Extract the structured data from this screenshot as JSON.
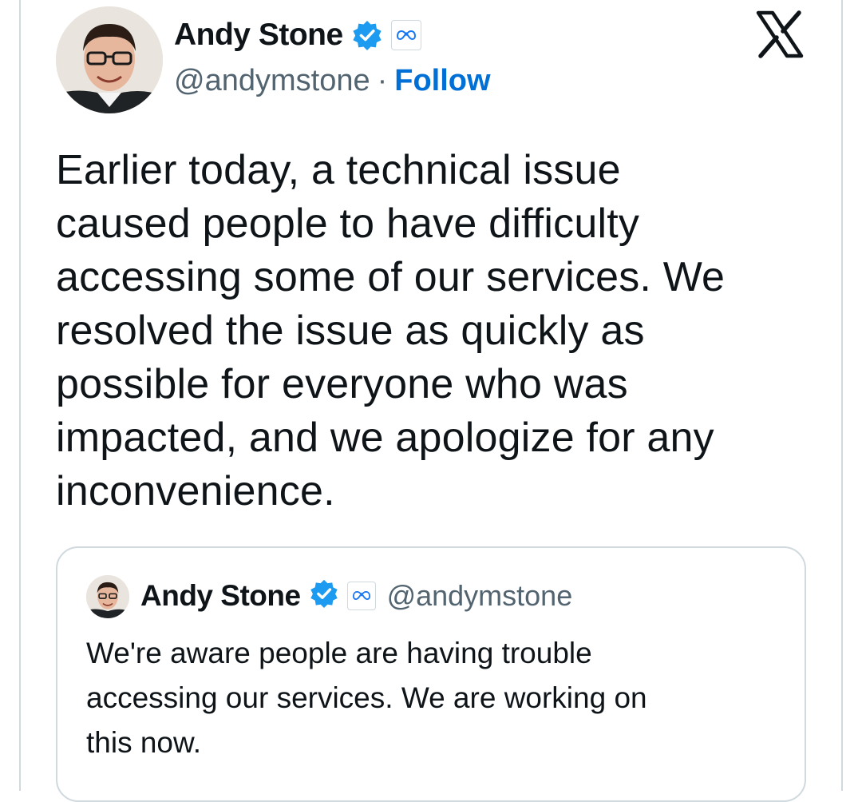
{
  "author": {
    "name": "Andy Stone",
    "handle": "@andymstone",
    "separator": "·",
    "follow_label": "Follow",
    "verified_icon": "verified-badge-icon",
    "affiliation_icon": "meta-logo-icon"
  },
  "platform": {
    "logo_icon": "x-logo-icon"
  },
  "tweet": {
    "text": "Earlier today, a technical issue\ncaused people to have difficulty\naccessing some of our services. We\nresolved the issue as quickly as\npossible for everyone who was\nimpacted, and we apologize for any\ninconvenience."
  },
  "quoted_tweet": {
    "name": "Andy Stone",
    "handle": "@andymstone",
    "text": "We're aware people are having trouble\naccessing our services. We are working on\nthis now."
  },
  "colors": {
    "follow": "#006fd6",
    "verified": "#1d9bf0",
    "secondary_text": "#536471",
    "border": "#cfd9de"
  }
}
